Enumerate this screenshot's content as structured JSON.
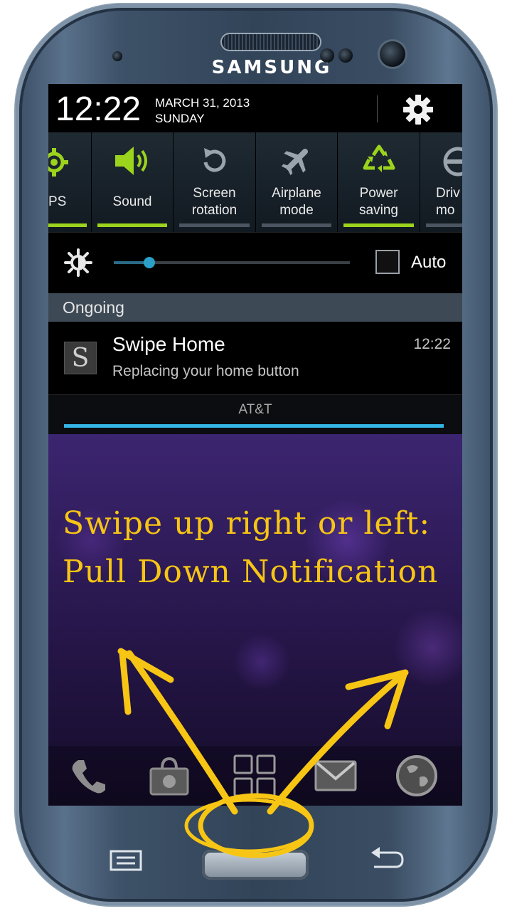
{
  "device": {
    "brand": "SAMSUNG"
  },
  "status_bar": {
    "time": "12:22",
    "date_line1": "MARCH 31, 2013",
    "date_line2": "SUNDAY"
  },
  "quick_settings": [
    {
      "label": "PS",
      "icon": "gps-icon",
      "active": true
    },
    {
      "label": "Sound",
      "icon": "sound-icon",
      "active": true
    },
    {
      "label": "Screen rotation",
      "icon": "rotation-icon",
      "active": false
    },
    {
      "label": "Airplane mode",
      "icon": "airplane-icon",
      "active": false
    },
    {
      "label": "Power saving",
      "icon": "recycle-icon",
      "active": true
    },
    {
      "label": "Driv mo",
      "icon": "driving-mode-icon",
      "active": false
    }
  ],
  "brightness": {
    "level": 0.15,
    "auto_label": "Auto",
    "auto_checked": false
  },
  "ongoing_header": "Ongoing",
  "notification": {
    "icon_letter": "S",
    "title": "Swipe Home",
    "subtitle": "Replacing your home button",
    "time": "12:22"
  },
  "carrier": "AT&T",
  "overlay": {
    "line1": "Swipe up right or left:",
    "line2": "Pull Down Notification"
  },
  "dock": [
    "phone-icon",
    "play-store-icon",
    "apps-grid-icon",
    "email-icon",
    "internet-globe-icon"
  ],
  "colors": {
    "accent_green": "#9bd31d",
    "accent_blue": "#33b5e5",
    "overlay_yellow": "#f7c514"
  }
}
